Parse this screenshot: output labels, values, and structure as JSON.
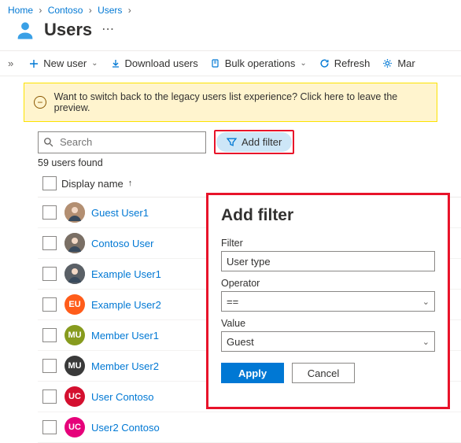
{
  "breadcrumbs": {
    "home": "Home",
    "contoso": "Contoso",
    "users": "Users"
  },
  "page_title": "Users",
  "toolbar": {
    "new_user": "New user",
    "download_users": "Download users",
    "bulk_ops": "Bulk operations",
    "refresh": "Refresh",
    "manage": "Mar"
  },
  "banner": "Want to switch back to the legacy users list experience? Click here to leave the preview.",
  "search_placeholder": "Search",
  "add_filter": "Add filter",
  "count": "59 users found",
  "columns": {
    "display_name": "Display name"
  },
  "users": [
    {
      "name": "Guest User1",
      "initials": "",
      "color": "#b38f72",
      "img": true
    },
    {
      "name": "Contoso User",
      "initials": "",
      "color": "#7a6f65",
      "img": true
    },
    {
      "name": "Example User1",
      "initials": "",
      "color": "#5a6066",
      "img": true
    },
    {
      "name": "Example User2",
      "initials": "EU",
      "color": "#ff5c1a",
      "img": false
    },
    {
      "name": "Member User1",
      "initials": "MU",
      "color": "#879b1e",
      "img": false
    },
    {
      "name": "Member User2",
      "initials": "MU",
      "color": "#3a3a3a",
      "img": false
    },
    {
      "name": "User Contoso",
      "initials": "UC",
      "color": "#d40f2f",
      "img": false
    },
    {
      "name": "User2 Contoso",
      "initials": "UC",
      "color": "#e6007a",
      "img": false
    }
  ],
  "filter_panel": {
    "title": "Add filter",
    "filter_label": "Filter",
    "filter_value": "User type",
    "operator_label": "Operator",
    "operator_value": "==",
    "value_label": "Value",
    "value_value": "Guest",
    "apply": "Apply",
    "cancel": "Cancel"
  }
}
